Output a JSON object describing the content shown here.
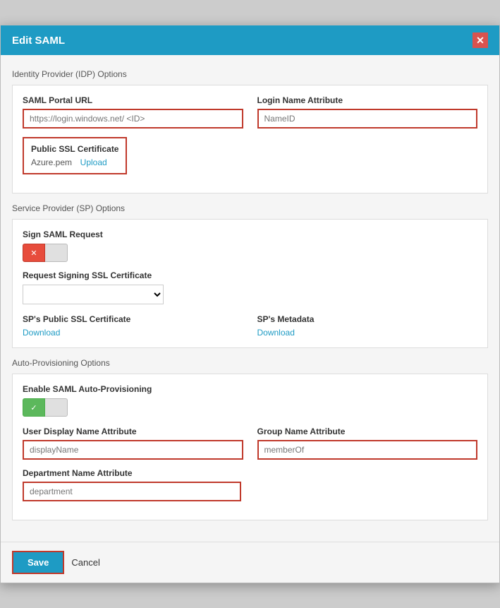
{
  "modal": {
    "title": "Edit SAML",
    "close_label": "✕"
  },
  "idp_section": {
    "label": "Identity Provider (IDP) Options",
    "saml_url": {
      "label": "SAML Portal URL",
      "placeholder": "https://login.windows.net/ <ID>"
    },
    "login_name": {
      "label": "Login Name Attribute",
      "placeholder": "NameID"
    },
    "cert": {
      "label": "Public SSL Certificate",
      "file": "Azure.pem",
      "upload_label": "Upload"
    }
  },
  "sp_section": {
    "label": "Service Provider (SP) Options",
    "sign_request": {
      "label": "Sign SAML Request",
      "toggle_off_icon": "✕"
    },
    "signing_cert": {
      "label": "Request Signing SSL Certificate",
      "placeholder": ""
    },
    "public_cert": {
      "label": "SP's Public SSL Certificate",
      "download_label": "Download"
    },
    "metadata": {
      "label": "SP's Metadata",
      "download_label": "Download"
    }
  },
  "auto_section": {
    "label": "Auto-Provisioning Options",
    "enable": {
      "label": "Enable SAML Auto-Provisioning",
      "toggle_on_icon": "✓"
    },
    "display_name": {
      "label": "User Display Name Attribute",
      "placeholder": "displayName"
    },
    "group_name": {
      "label": "Group Name Attribute",
      "placeholder": "memberOf"
    },
    "department": {
      "label": "Department Name Attribute",
      "placeholder": "department"
    }
  },
  "footer": {
    "save_label": "Save",
    "cancel_label": "Cancel"
  }
}
